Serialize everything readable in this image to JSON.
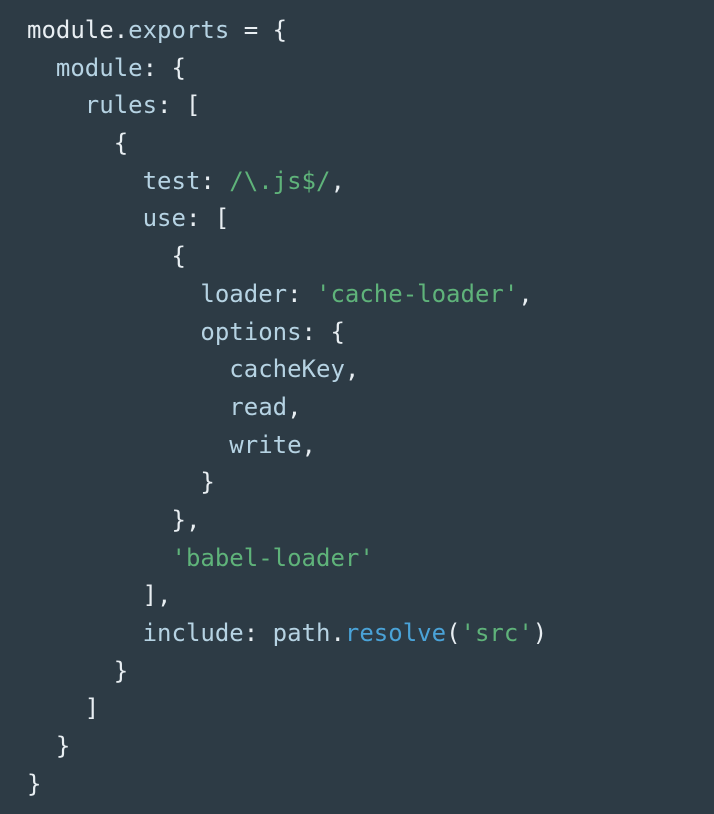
{
  "theme": {
    "background": "#2d3b45",
    "plain": "#e8eef2",
    "property": "#b6d3e3",
    "string": "#5fb37a",
    "function": "#4aa3d8"
  },
  "code": {
    "language": "javascript",
    "lines": [
      [
        {
          "t": "module",
          "k": "plain"
        },
        {
          "t": ".",
          "k": "punct"
        },
        {
          "t": "exports",
          "k": "prop"
        },
        {
          "t": " = {",
          "k": "punct"
        }
      ],
      [
        {
          "t": "  ",
          "k": "plain"
        },
        {
          "t": "module",
          "k": "prop"
        },
        {
          "t": ": {",
          "k": "punct"
        }
      ],
      [
        {
          "t": "    ",
          "k": "plain"
        },
        {
          "t": "rules",
          "k": "prop"
        },
        {
          "t": ": [",
          "k": "punct"
        }
      ],
      [
        {
          "t": "      {",
          "k": "punct"
        }
      ],
      [
        {
          "t": "        ",
          "k": "plain"
        },
        {
          "t": "test",
          "k": "prop"
        },
        {
          "t": ": ",
          "k": "punct"
        },
        {
          "t": "/\\.js$/",
          "k": "regex"
        },
        {
          "t": ",",
          "k": "punct"
        }
      ],
      [
        {
          "t": "        ",
          "k": "plain"
        },
        {
          "t": "use",
          "k": "prop"
        },
        {
          "t": ": [",
          "k": "punct"
        }
      ],
      [
        {
          "t": "          {",
          "k": "punct"
        }
      ],
      [
        {
          "t": "            ",
          "k": "plain"
        },
        {
          "t": "loader",
          "k": "prop"
        },
        {
          "t": ": ",
          "k": "punct"
        },
        {
          "t": "'cache-loader'",
          "k": "string"
        },
        {
          "t": ",",
          "k": "punct"
        }
      ],
      [
        {
          "t": "            ",
          "k": "plain"
        },
        {
          "t": "options",
          "k": "prop"
        },
        {
          "t": ": {",
          "k": "punct"
        }
      ],
      [
        {
          "t": "              ",
          "k": "plain"
        },
        {
          "t": "cacheKey",
          "k": "prop"
        },
        {
          "t": ",",
          "k": "punct"
        }
      ],
      [
        {
          "t": "              ",
          "k": "plain"
        },
        {
          "t": "read",
          "k": "prop"
        },
        {
          "t": ",",
          "k": "punct"
        }
      ],
      [
        {
          "t": "              ",
          "k": "plain"
        },
        {
          "t": "write",
          "k": "prop"
        },
        {
          "t": ",",
          "k": "punct"
        }
      ],
      [
        {
          "t": "            }",
          "k": "punct"
        }
      ],
      [
        {
          "t": "          },",
          "k": "punct"
        }
      ],
      [
        {
          "t": "          ",
          "k": "plain"
        },
        {
          "t": "'babel-loader'",
          "k": "string"
        }
      ],
      [
        {
          "t": "        ],",
          "k": "punct"
        }
      ],
      [
        {
          "t": "        ",
          "k": "plain"
        },
        {
          "t": "include",
          "k": "prop"
        },
        {
          "t": ": ",
          "k": "punct"
        },
        {
          "t": "path",
          "k": "prop"
        },
        {
          "t": ".",
          "k": "punct"
        },
        {
          "t": "resolve",
          "k": "func"
        },
        {
          "t": "(",
          "k": "punct"
        },
        {
          "t": "'src'",
          "k": "string"
        },
        {
          "t": ")",
          "k": "punct"
        }
      ],
      [
        {
          "t": "      }",
          "k": "punct"
        }
      ],
      [
        {
          "t": "    ]",
          "k": "punct"
        }
      ],
      [
        {
          "t": "  }",
          "k": "punct"
        }
      ],
      [
        {
          "t": "}",
          "k": "punct"
        }
      ]
    ]
  }
}
